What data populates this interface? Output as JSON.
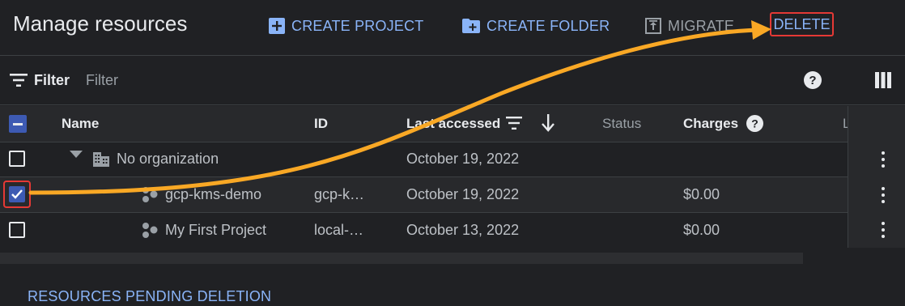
{
  "page_title": "Manage resources",
  "toolbar": {
    "create_project": "CREATE PROJECT",
    "create_folder": "CREATE FOLDER",
    "migrate": "MIGRATE",
    "delete": "DELETE"
  },
  "filter": {
    "label": "Filter",
    "placeholder": "Filter"
  },
  "columns": {
    "name": "Name",
    "id": "ID",
    "last_accessed": "Last accessed",
    "status": "Status",
    "charges": "Charges",
    "labels": "L"
  },
  "rows": [
    {
      "name": "No organization",
      "id": "",
      "last_accessed": "October 19, 2022",
      "charges": "",
      "checked": false,
      "type": "organization"
    },
    {
      "name": "gcp-kms-demo",
      "id": "gcp-k…",
      "last_accessed": "October 19, 2022",
      "charges": "$0.00",
      "checked": true,
      "type": "project"
    },
    {
      "name": "My First Project",
      "id": "local-…",
      "last_accessed": "October 13, 2022",
      "charges": "$0.00",
      "checked": false,
      "type": "project"
    }
  ],
  "pending_section": "RESOURCES PENDING DELETION",
  "colors": {
    "accent": "#8ab4f8",
    "checkbox_checked": "#3d5ab3",
    "annotation_arrow": "#f9a825",
    "highlight_box": "#e53935"
  }
}
